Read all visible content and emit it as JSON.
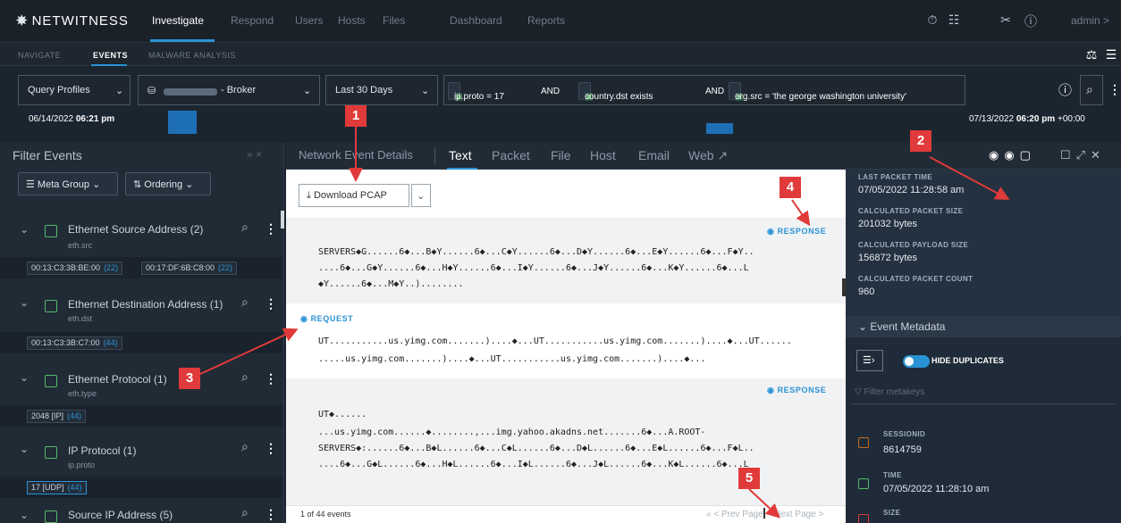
{
  "app": {
    "brand": "NETWITNESS",
    "user": "admin >"
  },
  "topnav": {
    "items": [
      "Investigate",
      "Respond",
      "Users",
      "Hosts",
      "Files",
      "Dashboard",
      "Reports"
    ],
    "active": "Investigate"
  },
  "subnav": {
    "items": [
      "NAVIGATE",
      "EVENTS",
      "MALWARE ANALYSIS"
    ],
    "active": "EVENTS"
  },
  "query": {
    "profiles": "Query Profiles",
    "broker": "- Broker",
    "range": "Last 30 Days",
    "pills": [
      {
        "text": "ip.proto = 17"
      },
      {
        "text": "country.dst exists"
      },
      {
        "text": "org.src = 'the george washington university'"
      }
    ],
    "and_label": "AND",
    "start_date": "06/14/2022",
    "start_time": "06:21 pm",
    "end_date": "07/13/2022",
    "end_time": "06:20 pm",
    "end_tz": "+00:00"
  },
  "filter": {
    "title": "Filter Events",
    "meta_group": "Meta Group",
    "ordering": "Ordering",
    "groups": [
      {
        "name": "Ethernet Source Address (2)",
        "key": "eth.src",
        "values": [
          {
            "v": "00:13:C3:3B:BE:00",
            "c": "(22)"
          },
          {
            "v": "00:17:DF:6B:C8:00",
            "c": "(22)"
          }
        ]
      },
      {
        "name": "Ethernet Destination Address (1)",
        "key": "eth.dst",
        "values": [
          {
            "v": "00:13:C3:3B:C7:00",
            "c": "(44)"
          }
        ]
      },
      {
        "name": "Ethernet Protocol (1)",
        "key": "eth.type",
        "values": [
          {
            "v": "2048 [IP]",
            "c": "(44)"
          }
        ]
      },
      {
        "name": "IP Protocol (1)",
        "key": "ip.proto",
        "values": [
          {
            "v": "17 [UDP]",
            "c": "(44)"
          }
        ]
      },
      {
        "name": "Source IP Address (5)",
        "key": "",
        "values": []
      }
    ]
  },
  "details": {
    "tabs": [
      "Network Event Details",
      "Text",
      "Packet",
      "File",
      "Host",
      "Email",
      "Web"
    ],
    "active_tab": "Text",
    "download": "Download PCAP",
    "response_label": "RESPONSE",
    "request_label": "REQUEST",
    "resp1": [
      "SERVERS◆G......6◆...B◆Y......6◆...C◆Y......6◆...D◆Y......6◆...E◆Y......6◆...F◆Y..",
      "....6◆...G◆Y......6◆...H◆Y......6◆...I◆Y......6◆...J◆Y......6◆...K◆Y......6◆...L",
      "◆Y......6◆...M◆Y..)........"
    ],
    "req": [
      "UT...........us.yimg.com.......)....◆...UT...........us.yimg.com.......)....◆...UT......",
      ".....us.yimg.com.......)....◆...UT...........us.yimg.com.......)....◆..."
    ],
    "resp2": [
      "UT◆......",
      "...us.yimg.com......◆........,...img.yahoo.akadns.net.......6◆...A.ROOT-",
      "SERVERS◆:......6◆...B◆L......6◆...C◆L......6◆...D◆L......6◆...E◆L......6◆...F◆L..",
      "....6◆...G◆L......6◆...H◆L......6◆...I◆L......6◆...J◆L......6◆...K◆L......6◆...L"
    ],
    "count": "1 of 44 events",
    "prev": "< Prev Page",
    "next": "Next Page >"
  },
  "summary": [
    {
      "label": "LAST PACKET TIME",
      "value": "07/05/2022 11:28:58 am"
    },
    {
      "label": "CALCULATED PACKET SIZE",
      "value": "201032 bytes"
    },
    {
      "label": "CALCULATED PAYLOAD SIZE",
      "value": "156872 bytes"
    },
    {
      "label": "CALCULATED PACKET COUNT",
      "value": "960"
    }
  ],
  "meta": {
    "title": "Event Metadata",
    "hide_dup": "HIDE DUPLICATES",
    "filter_placeholder": "Filter metakeys",
    "items": [
      {
        "key": "SESSIONID",
        "value": "8614759"
      },
      {
        "key": "TIME",
        "value": "07/05/2022 11:28:10 am"
      },
      {
        "key": "SIZE",
        "value": ""
      }
    ]
  },
  "annotations": [
    "1",
    "2",
    "3",
    "4",
    "5"
  ],
  "colors": {
    "accent": "#2a93d5",
    "annotation": "#e03a3a",
    "timeline": "#1f6fb5"
  }
}
